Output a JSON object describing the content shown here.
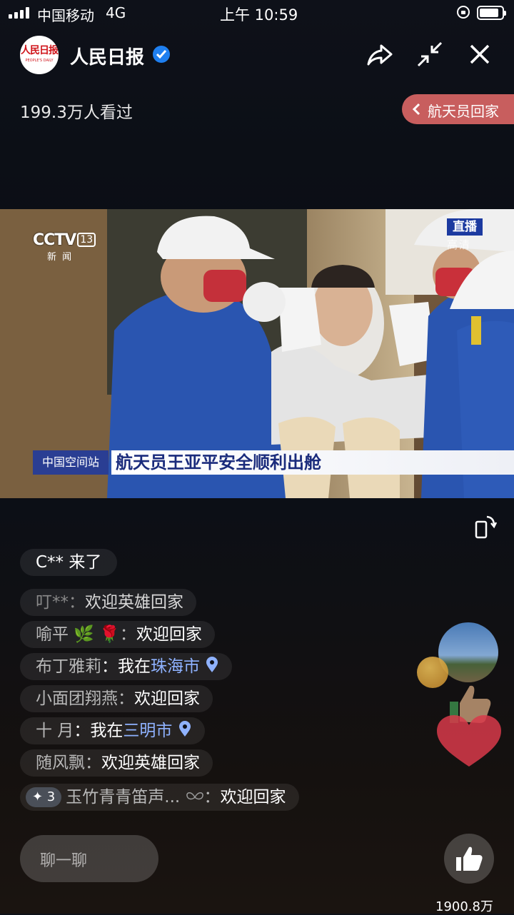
{
  "status_bar": {
    "carrier": "中国移动",
    "network": "4G",
    "time": "上午 10:59",
    "battery_fraction": 0.85
  },
  "header": {
    "logo_text": "人民日报",
    "logo_subtext": "PEOPLE'S DAILY",
    "account_name": "人民日报",
    "viewers": "199.3万人看过",
    "tag_label": "航天员回家"
  },
  "video": {
    "channel_logo": "CCTV",
    "channel_number": "13",
    "channel_sub": "新 闻",
    "live_badge": "直播",
    "quality_label": "高清",
    "ticker_left": "中国空间站",
    "ticker_main": "航天员王亚平安全顺利出舱"
  },
  "join_message": "C** 来了",
  "comments": [
    {
      "nick": "叮**",
      "emoji": "",
      "prefix": "：",
      "text": "欢迎英雄回家",
      "city": ""
    },
    {
      "nick": "喻平",
      "emoji": "🌿 🌹",
      "prefix": "：",
      "text": "欢迎回家",
      "city": ""
    },
    {
      "nick": "布丁雅莉",
      "emoji": "",
      "prefix": "：我在",
      "text": "",
      "city": "珠海市"
    },
    {
      "nick": "小面团翔燕",
      "emoji": "",
      "prefix": "：",
      "text": "欢迎回家",
      "city": ""
    },
    {
      "nick": "十 月",
      "emoji": "",
      "prefix": "：我在",
      "text": "",
      "city": "三明市"
    },
    {
      "nick": "随风飘",
      "emoji": "",
      "prefix": "：",
      "text": "欢迎英雄回家",
      "city": ""
    },
    {
      "nick": "玉竹青青笛声...",
      "emoji": "",
      "prefix": "：",
      "text": "欢迎回家",
      "city": "",
      "badge": "✦ 3"
    }
  ],
  "bottom": {
    "chat_placeholder": "聊一聊",
    "like_count": "1900.8万"
  },
  "colors": {
    "tag_bg": "#c85e5e",
    "verified": "#1e7ff0",
    "city_link": "#8fb2ff",
    "ticker_blue": "#2a3e93"
  },
  "icons": [
    "signal-icon",
    "lock-rotation-icon",
    "battery-icon",
    "verified-icon",
    "share-icon",
    "minimize-icon",
    "close-icon",
    "chevron-left-icon",
    "rotate-screen-icon",
    "location-pin-icon",
    "thumbs-up-icon",
    "heart-icon"
  ]
}
